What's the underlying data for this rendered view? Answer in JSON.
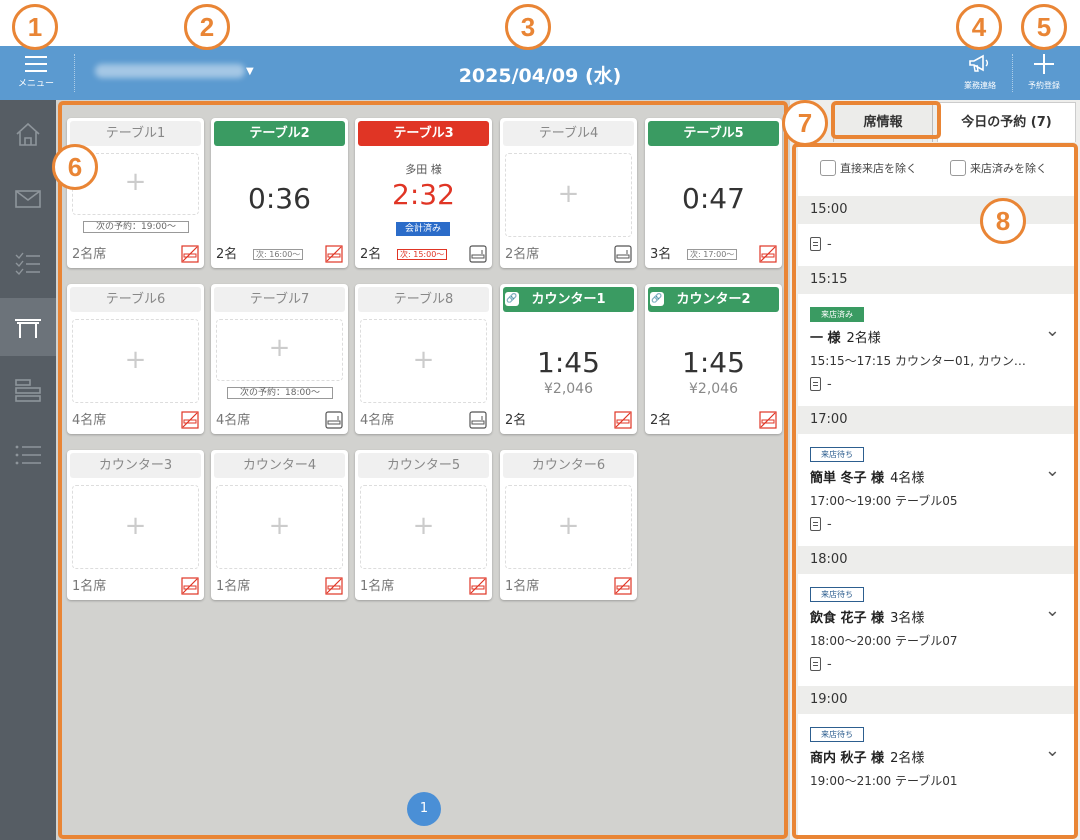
{
  "header": {
    "menu_label": "メニュー",
    "date": "2025/04/09 (水)",
    "notice_label": "業務連絡",
    "add_res_label": "予約登録"
  },
  "sidebar": {
    "items": [
      "home-icon",
      "mail-icon",
      "checklist-icon",
      "table-icon",
      "timeline-icon",
      "list-icon"
    ],
    "active": "table-icon"
  },
  "tables": [
    {
      "title": "テーブル1",
      "state": "empty",
      "next": "次の予約：19:00〜",
      "seats": "2名席",
      "icon": "no-smoking"
    },
    {
      "title": "テーブル2",
      "state": "occupied",
      "time": "0:36",
      "guests": "2名",
      "next": "次: 16:00〜",
      "icon": "no-smoking"
    },
    {
      "title": "テーブル3",
      "state": "overdue",
      "guest": "多田 様",
      "time": "2:32",
      "badge": "会計済み",
      "guests": "2名",
      "next": "次: 15:00〜",
      "icon": "smoking"
    },
    {
      "title": "テーブル4",
      "state": "empty",
      "seats": "2名席",
      "icon": "smoking"
    },
    {
      "title": "テーブル5",
      "state": "occupied",
      "time": "0:47",
      "guests": "3名",
      "next": "次: 17:00〜",
      "icon": "no-smoking"
    },
    {
      "title": "テーブル6",
      "state": "empty",
      "seats": "4名席",
      "icon": "no-smoking"
    },
    {
      "title": "テーブル7",
      "state": "empty",
      "next": "次の予約：18:00〜",
      "seats": "4名席",
      "icon": "smoking"
    },
    {
      "title": "テーブル8",
      "state": "empty",
      "seats": "4名席",
      "icon": "smoking"
    },
    {
      "title": "カウンター1",
      "state": "linked",
      "time": "1:45",
      "price": "¥2,046",
      "guests": "2名",
      "icon": "no-smoking"
    },
    {
      "title": "カウンター2",
      "state": "linked",
      "time": "1:45",
      "price": "¥2,046",
      "guests": "2名",
      "icon": "no-smoking"
    },
    {
      "title": "カウンター3",
      "state": "empty",
      "seats": "1名席",
      "icon": "no-smoking"
    },
    {
      "title": "カウンター4",
      "state": "empty",
      "seats": "1名席",
      "icon": "no-smoking"
    },
    {
      "title": "カウンター5",
      "state": "empty",
      "seats": "1名席",
      "icon": "no-smoking"
    },
    {
      "title": "カウンター6",
      "state": "empty",
      "seats": "1名席",
      "icon": "no-smoking"
    }
  ],
  "pager": {
    "current": "1"
  },
  "right": {
    "tab_seat": "席情報",
    "tab_res": "今日の予約 (7)",
    "filter_walkin": "直接来店を除く",
    "filter_arrived": "来店済みを除く",
    "groups": [
      {
        "time": "15:00",
        "entries": [
          {
            "memo": "-"
          }
        ]
      },
      {
        "time": "15:15",
        "entries": [
          {
            "status": "来店済み",
            "status_type": "done",
            "name": "一 様",
            "count": "2名様",
            "detail": "15:15～17:15  カウンター01, カウン…",
            "memo": "-"
          }
        ]
      },
      {
        "time": "17:00",
        "entries": [
          {
            "status": "来店待ち",
            "status_type": "wait",
            "name": "簡単 冬子 様",
            "count": "4名様",
            "detail": "17:00～19:00  テーブル05",
            "memo": "-"
          }
        ]
      },
      {
        "time": "18:00",
        "entries": [
          {
            "status": "来店待ち",
            "status_type": "wait",
            "name": "飲食 花子 様",
            "count": "3名様",
            "detail": "18:00～20:00  テーブル07",
            "memo": "-"
          }
        ]
      },
      {
        "time": "19:00",
        "entries": [
          {
            "status": "来店待ち",
            "status_type": "wait",
            "name": "商内 秋子 様",
            "count": "2名様",
            "detail": "19:00～21:00  テーブル01",
            "memo": ""
          }
        ]
      }
    ]
  },
  "callouts": [
    "1",
    "2",
    "3",
    "4",
    "5",
    "6",
    "7",
    "8"
  ],
  "colors": {
    "header": "#5b9ad0",
    "sidebar": "#565d64",
    "green": "#3a9b62",
    "red": "#e03525",
    "annotation": "#e98535"
  }
}
